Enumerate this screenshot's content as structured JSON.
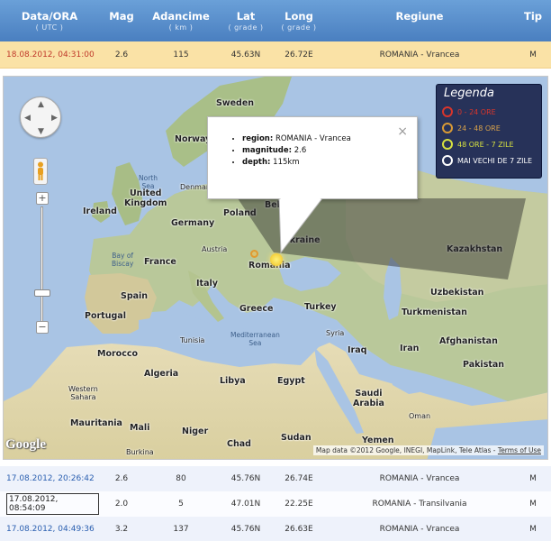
{
  "table": {
    "headers": [
      {
        "title": "Data/ORA",
        "sub": "( UTC )"
      },
      {
        "title": "Mag",
        "sub": ""
      },
      {
        "title": "Adancime",
        "sub": "( km )"
      },
      {
        "title": "Lat",
        "sub": "( grade )"
      },
      {
        "title": "Long",
        "sub": "( grade )"
      },
      {
        "title": "Regiune",
        "sub": ""
      },
      {
        "title": "Tip",
        "sub": ""
      }
    ],
    "highlighted": {
      "date": "18.08.2012, 04:31:00",
      "mag": "2.6",
      "depth": "115",
      "lat": "45.63N",
      "long": "26.72E",
      "region": "ROMANIA - Vrancea",
      "type": "M"
    },
    "rows": [
      {
        "date": "17.08.2012, 20:26:42",
        "mag": "2.6",
        "depth": "80",
        "lat": "45.76N",
        "long": "26.74E",
        "region": "ROMANIA - Vrancea",
        "type": "M"
      },
      {
        "date": "17.08.2012, 08:54:09",
        "mag": "2.0",
        "depth": "5",
        "lat": "47.01N",
        "long": "22.25E",
        "region": "ROMANIA - Transilvania",
        "type": "M"
      },
      {
        "date": "17.08.2012, 04:49:36",
        "mag": "3.2",
        "depth": "137",
        "lat": "45.76N",
        "long": "26.63E",
        "region": "ROMANIA - Vrancea",
        "type": "M"
      }
    ]
  },
  "map": {
    "legend": {
      "title": "Legenda",
      "items": [
        {
          "label": "0 - 24 ORE",
          "color": "#d9352b"
        },
        {
          "label": "24 - 48 ORE",
          "color": "#d99a35"
        },
        {
          "label": "48 ORE - 7 ZILE",
          "color": "#d6e040"
        },
        {
          "label": "MAI VECHI DE 7 ZILE",
          "color": "#ffffff"
        }
      ]
    },
    "info": {
      "region_label": "region:",
      "region_value": "ROMANIA - Vrancea",
      "magnitude_label": "magnitude:",
      "magnitude_value": "2.6",
      "depth_label": "depth:",
      "depth_value": "115km",
      "close": "×"
    },
    "labels": {
      "sweden": "Sweden",
      "norway": "Norway",
      "north_sea": "North\nSea",
      "denmark": "Denmark",
      "united_kingdom": "United\nKingdom",
      "ireland": "Ireland",
      "belarus": "Belarus",
      "germany": "Germany",
      "poland": "Poland",
      "ukraine": "Ukraine",
      "kazakhstan": "Kazakhstan",
      "bay_of_biscay": "Bay of\nBiscay",
      "france": "France",
      "austria": "Austria",
      "romania": "Romania",
      "italy": "Italy",
      "spain": "Spain",
      "portugal": "Portugal",
      "greece": "Greece",
      "turkey": "Turkey",
      "uzbekistan": "Uzbekistan",
      "turkmenistan": "Turkmenistan",
      "tunisia": "Tunisia",
      "mediterranean_sea": "Mediterranean\nSea",
      "syria": "Syria",
      "iraq": "Iraq",
      "iran": "Iran",
      "afghanistan": "Afghanistan",
      "pakistan": "Pakistan",
      "morocco": "Morocco",
      "algeria": "Algeria",
      "libya": "Libya",
      "egypt": "Egypt",
      "western_sahara": "Western\nSahara",
      "saudi_arabia": "Saudi\nArabia",
      "oman": "Oman",
      "mauritania": "Mauritania",
      "mali": "Mali",
      "niger": "Niger",
      "chad": "Chad",
      "sudan": "Sudan",
      "yemen": "Yemen",
      "burkina": "Burkina"
    },
    "google_logo": "Google",
    "attribution": "Map data ©2012 Google, INEGI, MapLink, Tele Atlas - ",
    "terms": "Terms of Use",
    "zoom_in": "+",
    "zoom_out": "−"
  }
}
